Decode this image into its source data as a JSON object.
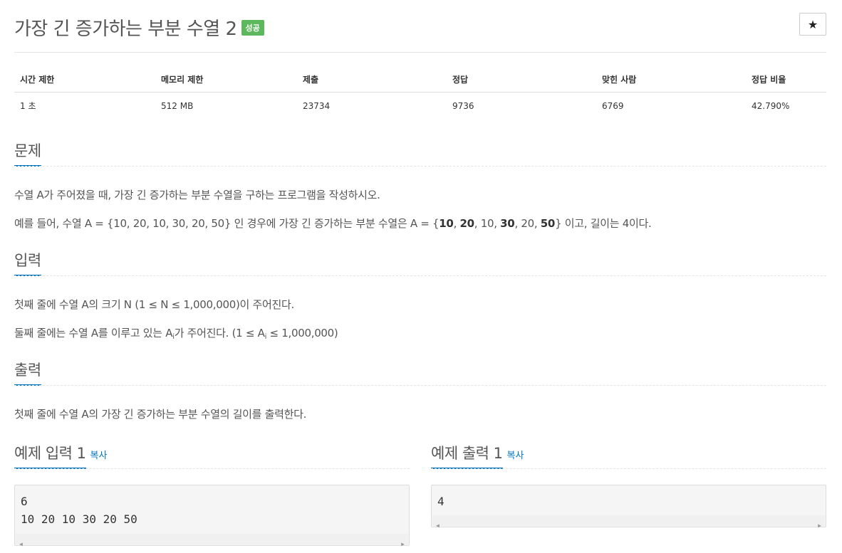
{
  "problem": {
    "title": "가장 긴 증가하는 부분 수열 2",
    "badge": "성공",
    "star_icon": "★"
  },
  "info_table": {
    "headers": [
      "시간 제한",
      "메모리 제한",
      "제출",
      "정답",
      "맞힌 사람",
      "정답 비율"
    ],
    "values": [
      "1 초",
      "512 MB",
      "23734",
      "9736",
      "6769",
      "42.790%"
    ]
  },
  "sections": {
    "problem_label": "문제",
    "problem_p1": "수열 A가 주어졌을 때, 가장 긴 증가하는 부분 수열을 구하는 프로그램을 작성하시오.",
    "problem_p2_prefix": "예를 들어, 수열 A = {10, 20, 10, 30, 20, 50} 인 경우에 가장 긴 증가하는 부분 수열은 A = {",
    "problem_p2_b1": "10",
    "problem_p2_sep1": ", ",
    "problem_p2_b2": "20",
    "problem_p2_mid": ", 10, ",
    "problem_p2_b3": "30",
    "problem_p2_mid2": ", 20, ",
    "problem_p2_b4": "50",
    "problem_p2_suffix": "} 이고, 길이는 4이다.",
    "input_label": "입력",
    "input_p1": "첫째 줄에 수열 A의 크기 N (1 ≤ N ≤ 1,000,000)이 주어진다.",
    "input_p2_a": "둘째 줄에는 수열 A를 이루고 있는 A",
    "input_p2_sub1": "i",
    "input_p2_b": "가 주어진다. (1 ≤ A",
    "input_p2_sub2": "i",
    "input_p2_c": " ≤ 1,000,000)",
    "output_label": "출력",
    "output_p1": "첫째 줄에 수열 A의 가장 긴 증가하는 부분 수열의 길이를 출력한다."
  },
  "samples": {
    "input_label": "예제 입력 1",
    "output_label": "예제 출력 1",
    "copy_label": "복사",
    "input_line1": "6",
    "input_line2": "10 20 10 30 20 50",
    "output_line1": "4"
  },
  "colors": {
    "accent": "#0076c0",
    "badge": "#5cb85c"
  }
}
